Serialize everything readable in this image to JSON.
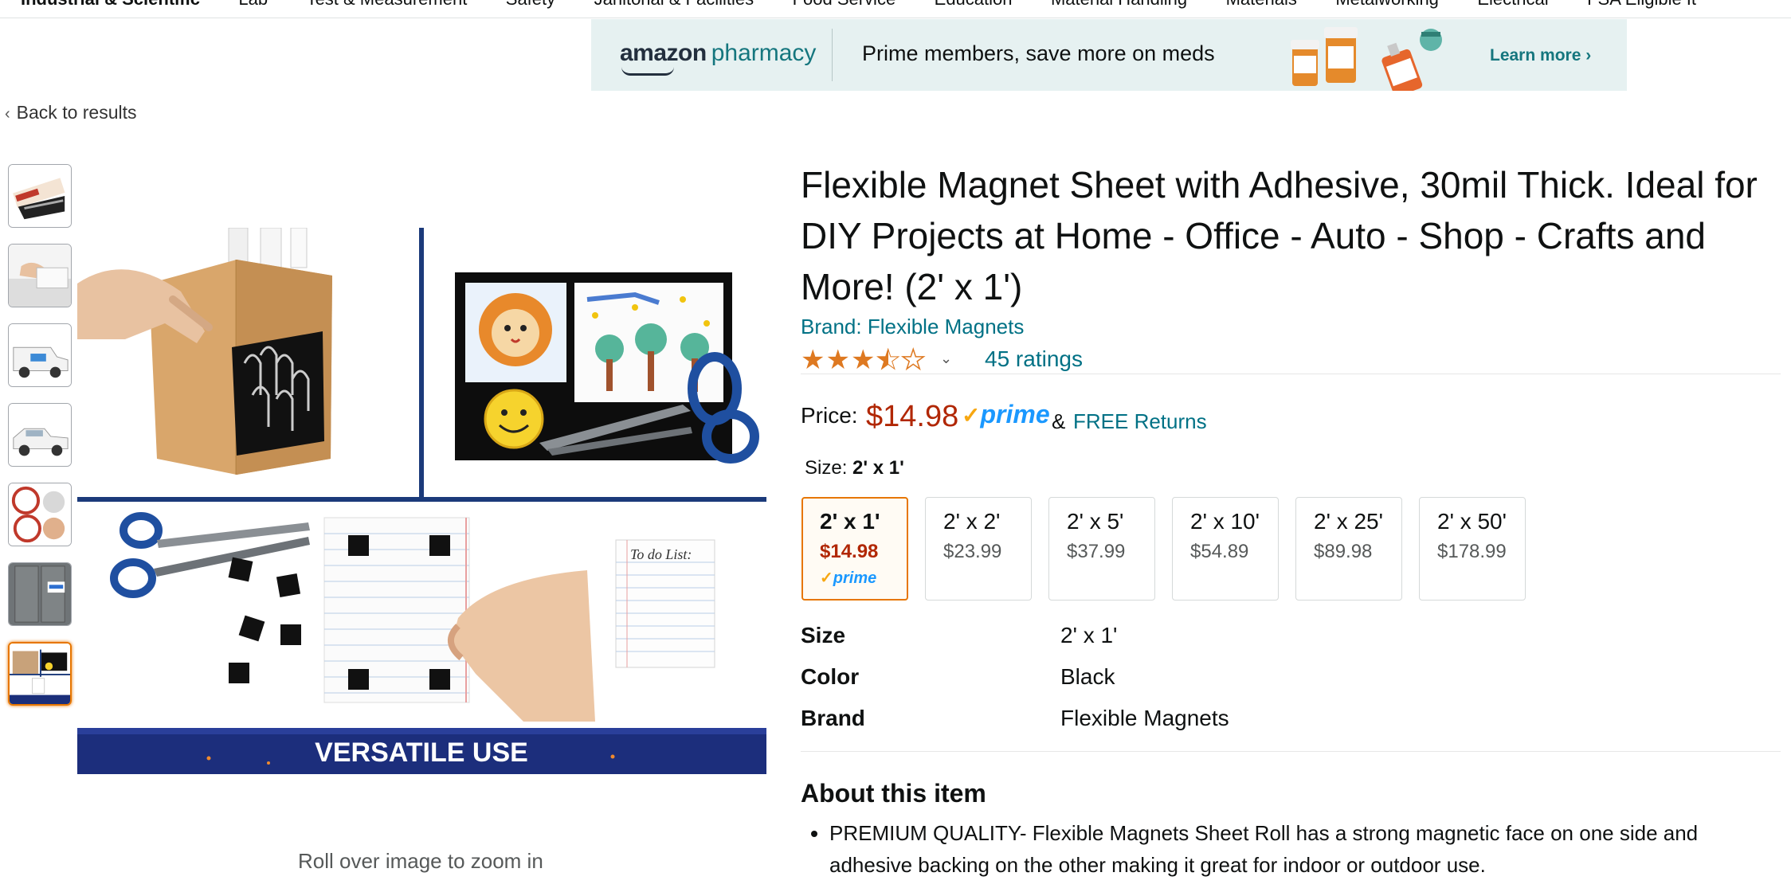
{
  "category_nav": [
    "Industrial & Scientific",
    "Lab",
    "Test & Measurement",
    "Safety",
    "Janitorial & Facilities",
    "Food Service",
    "Education",
    "Material Handling",
    "Materials",
    "Metalworking",
    "Electrical",
    "FSA Eligible It"
  ],
  "banner": {
    "logo_amazon": "amazon",
    "logo_pharmacy": "pharmacy",
    "message": "Prime members, save more on meds",
    "cta": "Learn more ›"
  },
  "back_link": "Back to results",
  "thumbnails_count": 7,
  "selected_thumbnail": 7,
  "main_image": {
    "caption": "VERSATILE USE",
    "note_text": "To do List:"
  },
  "zoom_hint": "Roll over image to zoom in",
  "product": {
    "title": "Flexible Magnet Sheet with Adhesive, 30mil Thick. Ideal for DIY Projects at Home - Office - Auto - Shop - Crafts and More! (2' x 1')",
    "brand": "Brand: Flexible Magnets",
    "rating": 3.5,
    "rating_max": 5,
    "ratings_count": "45 ratings",
    "price_label": "Price:",
    "price": "$14.98",
    "prime": "prime",
    "amp": "&",
    "returns": "FREE Returns",
    "size_label": "Size:",
    "size_selected": "2' x 1'"
  },
  "sizes": [
    {
      "size": "2' x 1'",
      "price": "$14.98",
      "prime": "prime",
      "selected": true
    },
    {
      "size": "2' x 2'",
      "price": "$23.99"
    },
    {
      "size": "2' x 5'",
      "price": "$37.99"
    },
    {
      "size": "2' x 10'",
      "price": "$54.89"
    },
    {
      "size": "2' x 25'",
      "price": "$89.98"
    },
    {
      "size": "2' x 50'",
      "price": "$178.99"
    }
  ],
  "specs": [
    {
      "key": "Size",
      "value": "2' x 1'"
    },
    {
      "key": "Color",
      "value": "Black"
    },
    {
      "key": "Brand",
      "value": "Flexible Magnets"
    }
  ],
  "about": {
    "heading": "About this item",
    "bullets": [
      "PREMIUM QUALITY- Flexible Magnets Sheet Roll has a strong magnetic face on one side and adhesive backing on the other making it great for indoor or outdoor use."
    ]
  },
  "colors": {
    "link": "#007185",
    "price": "#b12704",
    "star": "#de7921",
    "selected_border": "#e77600",
    "banner_bg": "#e6f1f1",
    "prime_blue": "#1a98ff"
  }
}
